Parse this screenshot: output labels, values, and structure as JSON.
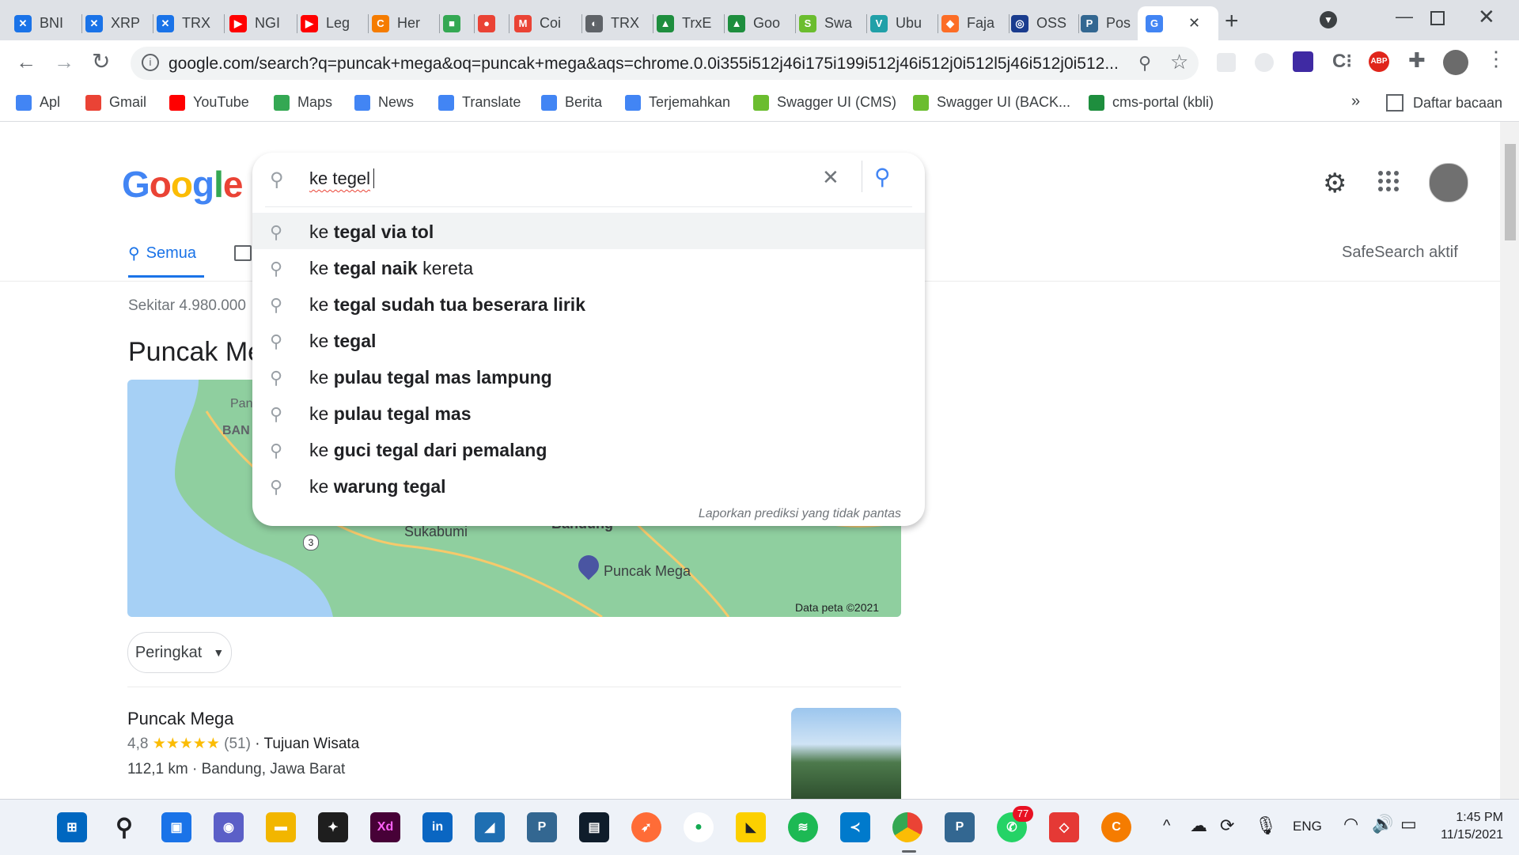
{
  "browser": {
    "tabs": [
      {
        "label": "BNI",
        "color": "#1a73e8",
        "glyph": "✕"
      },
      {
        "label": "XRP",
        "color": "#1a73e8",
        "glyph": "✕"
      },
      {
        "label": "TRX",
        "color": "#1a73e8",
        "glyph": "✕"
      },
      {
        "label": "NGI",
        "color": "#ff0000",
        "glyph": "▶"
      },
      {
        "label": "Leg",
        "color": "#ff0000",
        "glyph": "▶"
      },
      {
        "label": "Her",
        "color": "#f57c00",
        "glyph": "C"
      },
      {
        "label": "",
        "color": "#34a853",
        "glyph": "■"
      },
      {
        "label": "",
        "color": "#ea4335",
        "glyph": "●"
      },
      {
        "label": "Coi",
        "color": "#ea4335",
        "glyph": "M"
      },
      {
        "label": "TRX",
        "color": "#5f6368",
        "glyph": "◐"
      },
      {
        "label": "TrxE",
        "color": "#1e8e3e",
        "glyph": "▲"
      },
      {
        "label": "Goo",
        "color": "#1e8e3e",
        "glyph": "▲"
      },
      {
        "label": "Swa",
        "color": "#6bbd2f",
        "glyph": "S"
      },
      {
        "label": "Ubu",
        "color": "#21a0a8",
        "glyph": "V"
      },
      {
        "label": "Faja",
        "color": "#fc6d26",
        "glyph": "◆"
      },
      {
        "label": "OSS",
        "color": "#1a3c8e",
        "glyph": "◎"
      },
      {
        "label": "Pos",
        "color": "#336791",
        "glyph": "P"
      },
      {
        "label": "",
        "color": "#4285f4",
        "glyph": "G"
      }
    ],
    "new_tab": "+",
    "url": "google.com/search?q=puncak+mega&oq=puncak+mega&aqs=chrome.0.0i355i512j46i175i199i512j46i512j0i512l5j46i512j0i512..."
  },
  "bookmarks": [
    {
      "label": "Apl",
      "color": "#4285f4"
    },
    {
      "label": "Gmail",
      "color": "#ea4335"
    },
    {
      "label": "YouTube",
      "color": "#ff0000"
    },
    {
      "label": "Maps",
      "color": "#34a853"
    },
    {
      "label": "News",
      "color": "#4285f4"
    },
    {
      "label": "Translate",
      "color": "#4285f4"
    },
    {
      "label": "Berita",
      "color": "#4285f4"
    },
    {
      "label": "Terjemahkan",
      "color": "#4285f4"
    },
    {
      "label": "Swagger UI (CMS)",
      "color": "#6bbd2f"
    },
    {
      "label": "Swagger UI (BACK...",
      "color": "#6bbd2f"
    },
    {
      "label": "cms-portal (kbli)",
      "color": "#1e8e3e"
    }
  ],
  "bookmarks_more": "»",
  "reading_list": "Daftar bacaan",
  "search": {
    "logo": "Google",
    "query": "ke tegel",
    "suggestions": [
      {
        "prefix": "ke ",
        "bold": "tegal via tol",
        "tail": ""
      },
      {
        "prefix": "ke ",
        "bold": "tegal naik",
        "tail": " kereta"
      },
      {
        "prefix": "ke ",
        "bold": "tegal sudah tua beserara lirik",
        "tail": ""
      },
      {
        "prefix": "ke ",
        "bold": "tegal",
        "tail": ""
      },
      {
        "prefix": "ke ",
        "bold": "pulau tegal mas lampung",
        "tail": ""
      },
      {
        "prefix": "ke ",
        "bold": "pulau tegal mas",
        "tail": ""
      },
      {
        "prefix": "ke ",
        "bold": "guci tegal dari pemalang",
        "tail": ""
      },
      {
        "prefix": "ke ",
        "bold": "warung tegal",
        "tail": ""
      }
    ],
    "report_text": "Laporkan prediksi yang tidak pantas"
  },
  "nav": {
    "all_label": "Semua",
    "safesearch": "SafeSearch aktif"
  },
  "results": {
    "count_text": "Sekitar 4.980.000",
    "heading": "Puncak Me",
    "map_labels": {
      "city1": "Sukabumi",
      "city2": "Bandung",
      "place": "Puncak Mega",
      "region1": "Pan",
      "region2": "BAN",
      "road": "3",
      "credit": "Data peta ©2021"
    },
    "sort_button": "Peringkat",
    "place": {
      "name": "Puncak Mega",
      "rating": "4,8",
      "stars": "★★★★★",
      "reviews": "(51)",
      "category": "· Tujuan Wisata",
      "distance": "112,1 km · Bandung, Jawa Barat"
    }
  },
  "taskbar": {
    "lang": "ENG",
    "time": "1:45 PM",
    "date": "11/15/2021",
    "whatsapp_badge": "77",
    "xd_label": "Xd",
    "in_label": "in"
  }
}
